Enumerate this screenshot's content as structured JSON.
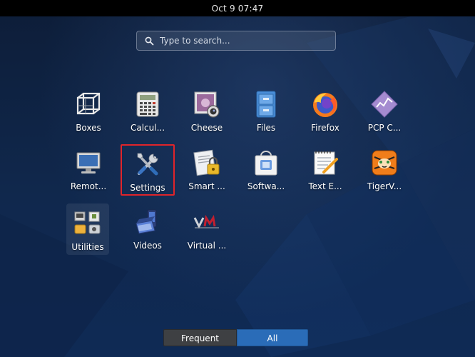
{
  "topbar": {
    "clock": "Oct 9  07:47"
  },
  "search": {
    "placeholder": "Type to search...",
    "icon": "search-icon"
  },
  "apps": [
    {
      "label": "Boxes",
      "icon": "boxes-icon"
    },
    {
      "label": "Calcul...",
      "icon": "calculator-icon"
    },
    {
      "label": "Cheese",
      "icon": "cheese-webcam-icon"
    },
    {
      "label": "Files",
      "icon": "file-cabinet-icon"
    },
    {
      "label": "Firefox",
      "icon": "firefox-icon"
    },
    {
      "label": "PCP C...",
      "icon": "pcp-icon"
    },
    {
      "label": "Remot...",
      "icon": "remote-desktop-icon"
    },
    {
      "label": "Settings",
      "icon": "settings-tools-icon",
      "selected": true
    },
    {
      "label": "Smart ...",
      "icon": "smart-card-lock-icon"
    },
    {
      "label": "Softwa...",
      "icon": "software-bag-icon"
    },
    {
      "label": "Text E...",
      "icon": "text-editor-icon"
    },
    {
      "label": "TigerV...",
      "icon": "tigervnc-icon"
    },
    {
      "label": "Utilities",
      "icon": "utilities-folder-icon",
      "folder": true
    },
    {
      "label": "Videos",
      "icon": "videos-icon"
    },
    {
      "label": "Virtual ...",
      "icon": "virtual-machine-icon"
    }
  ],
  "tabs": {
    "frequent": "Frequent",
    "all": "All",
    "active": "All"
  },
  "colors": {
    "selection_outline": "#e0242a",
    "active_tab": "#2a6cb8",
    "inactive_tab": "#3e4043",
    "topbar": "#000000"
  }
}
